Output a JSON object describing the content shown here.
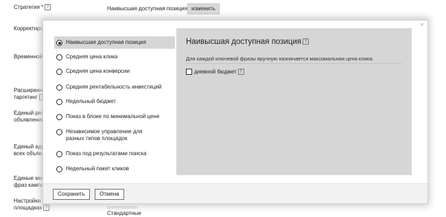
{
  "background": {
    "strategy_label": "Стратегия *",
    "current_strategy": "Наивысшая доступная позиция",
    "change_button": "изменить",
    "labels": [
      "Корректиро",
      "Временной",
      "Расширенн",
      "таргетинг",
      "Единый рег",
      "объявлений",
      "Единый адр",
      "всех объявл",
      "Единые мин",
      "фраз кампа",
      "Настройки н",
      "площадках"
    ],
    "bottom_text": "Стандартные"
  },
  "modal": {
    "close_icon": "×",
    "options": [
      {
        "label": "Наивысшая доступная позиция",
        "selected": true
      },
      {
        "label": "Средняя цена клика",
        "selected": false
      },
      {
        "label": "Средняя цена конверсии",
        "selected": false
      },
      {
        "label": "Средняя рентабельность инвестиций",
        "selected": false
      },
      {
        "label": "Недельный бюджет",
        "selected": false
      },
      {
        "label": "Показ в блоке по минимальной цене",
        "selected": false
      },
      {
        "label": "Независимое управление для разных типов площадок",
        "selected": false
      },
      {
        "label": "Показ под результатами поиска",
        "selected": false
      },
      {
        "label": "Недельный пакет кликов",
        "selected": false
      }
    ],
    "panel": {
      "title": "Наивысшая доступная позиция",
      "description": "Для каждой ключевой фразы вручную назначается максимальная цена клика.",
      "checkbox_label": "дневной бюджет",
      "checkbox_checked": false
    },
    "footer": {
      "save_label": "Сохранить",
      "cancel_label": "Отмена"
    }
  }
}
